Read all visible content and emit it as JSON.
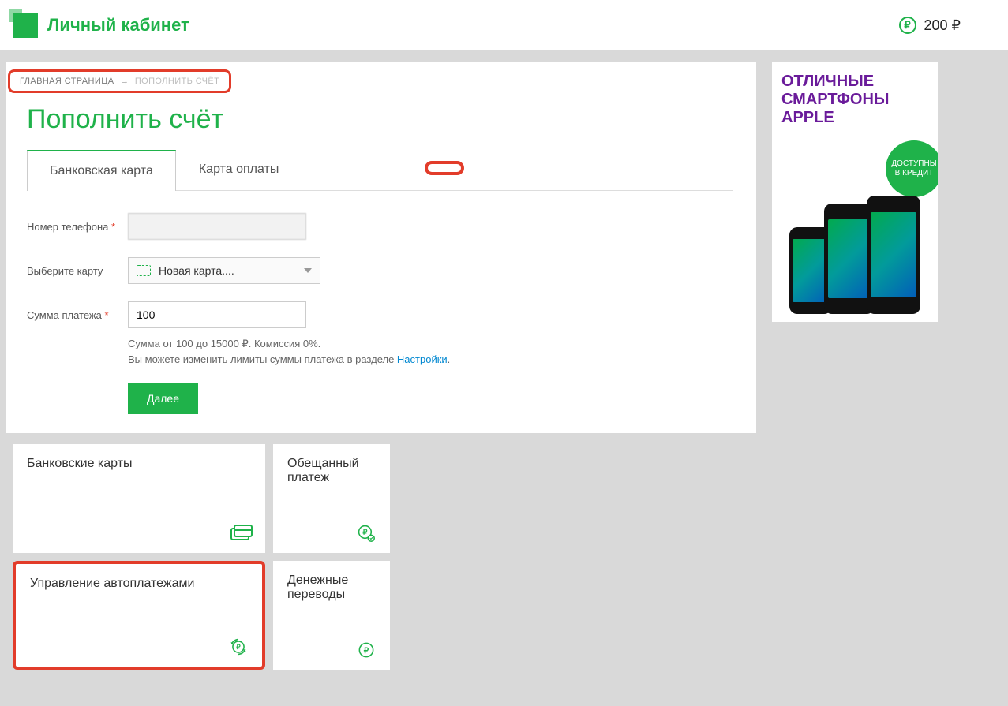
{
  "header": {
    "title": "Личный кабинет",
    "balance": "200 ₽"
  },
  "breadcrumb": {
    "home": "ГЛАВНАЯ СТРАНИЦА",
    "arrow": "→",
    "current": "ПОПОЛНИТЬ СЧЁТ"
  },
  "page": {
    "title": "Пополнить счёт"
  },
  "tabs": {
    "bank_card": "Банковская карта",
    "payment_card": "Карта оплаты"
  },
  "form": {
    "phone_label": "Номер телефона",
    "card_label": "Выберите карту",
    "card_selected": "Новая карта....",
    "amount_label": "Сумма платежа",
    "amount_value": "100",
    "hint_line1": "Сумма от 100 до 15000 ₽. Комиссия 0%.",
    "hint_line2_a": "Вы можете изменить лимиты суммы платежа в разделе ",
    "hint_settings": "Настройки",
    "hint_dot": ".",
    "next": "Далее"
  },
  "tiles": {
    "bank_cards": "Банковские карты",
    "promised": "Обещанный платеж",
    "autopay": "Управление автоплатежами",
    "transfer": "Денежные переводы"
  },
  "ad": {
    "line1": "ОТЛИЧНЫЕ",
    "line2": "СМАРТФОНЫ",
    "line3": "APPLE",
    "badge": "ДОСТУПНЫ В КРЕДИТ"
  }
}
